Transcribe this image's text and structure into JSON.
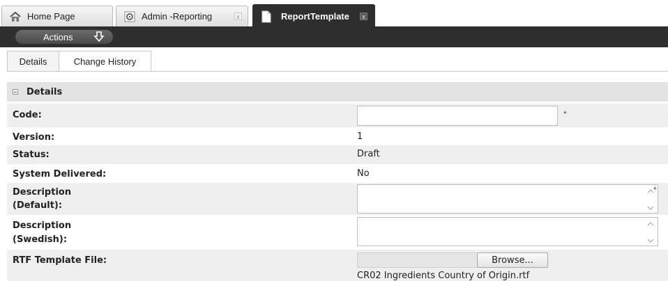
{
  "tabs": [
    {
      "label": "Home Page",
      "icon": "home-icon"
    },
    {
      "label": "Admin -Reporting",
      "icon": "gear-icon",
      "close": "x"
    },
    {
      "label": "ReportTemplate",
      "icon": "document-icon",
      "close": "x",
      "active": true
    }
  ],
  "actionbar": {
    "actions_label": "Actions",
    "icon": "download-arrow-icon"
  },
  "subtabs": [
    "Details",
    "Change History"
  ],
  "section": {
    "title": "Details",
    "icon": "collapse-icon"
  },
  "form": {
    "code_label": "Code:",
    "code_value": "",
    "required_mark": "*",
    "version_label": "Version:",
    "version_value": "1",
    "status_label": "Status:",
    "status_value": "Draft",
    "system_delivered_label": "System Delivered:",
    "system_delivered_value": "No",
    "desc_default_label_1": "Description",
    "desc_default_label_2": "(Default):",
    "desc_swedish_label_1": "Description",
    "desc_swedish_label_2": "(Swedish):",
    "rtf_label": "RTF Template File:",
    "browse_label": "Browse...",
    "rtf_filename": "CR02 Ingredients Country of Origin.rtf"
  },
  "colors": {
    "dark_bar": "#2e2e2e",
    "section_bg": "#e3e3e3",
    "row_shade": "#efefef"
  }
}
